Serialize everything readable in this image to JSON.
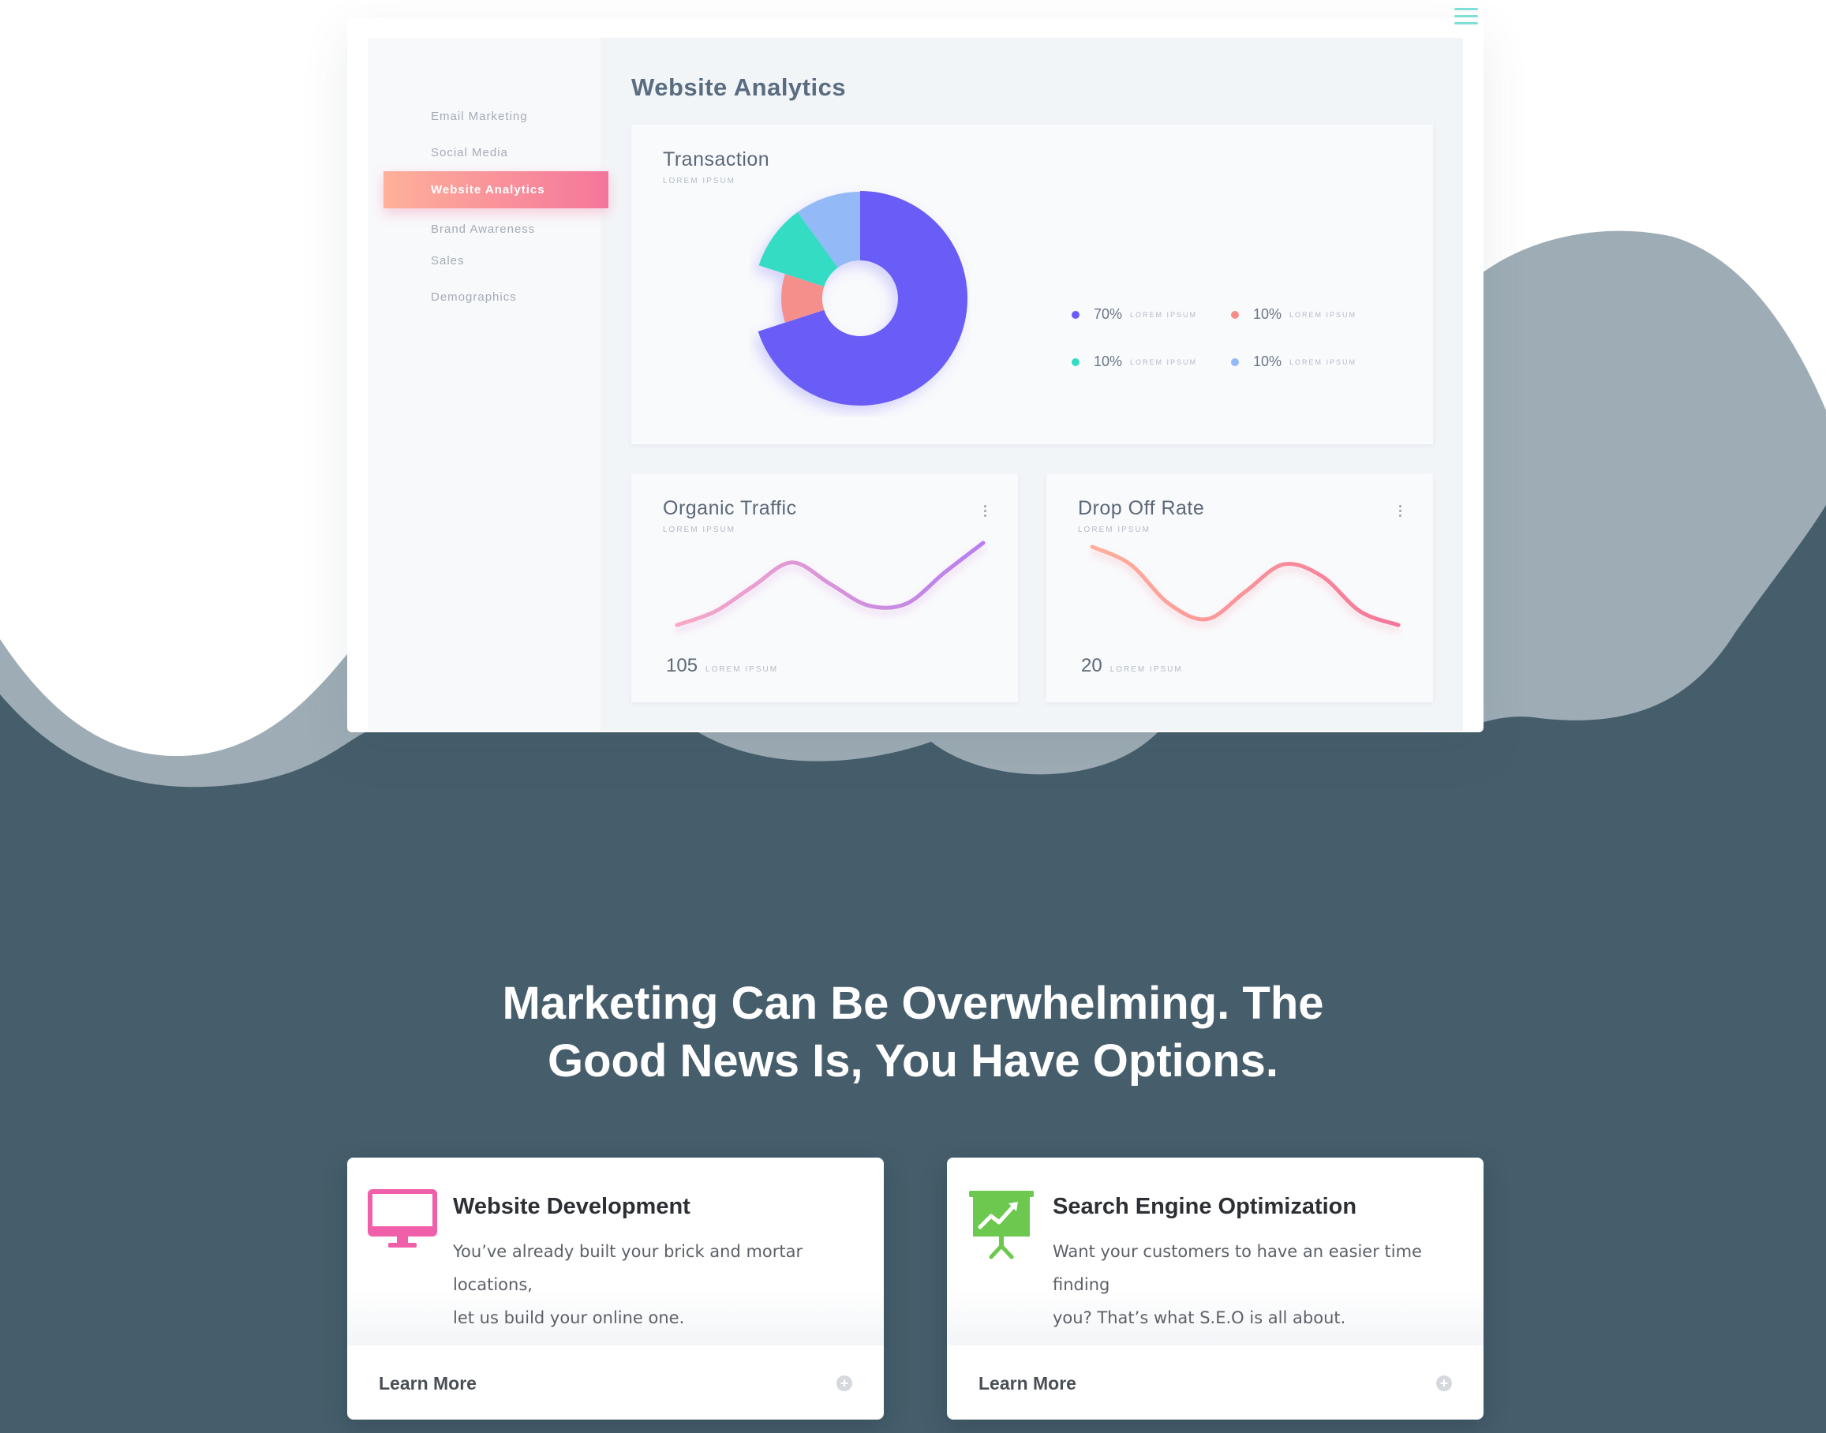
{
  "colors": {
    "dark_band": "#465e6b",
    "wave_gray": "#9eadb5",
    "accent_pink": "#f4769b",
    "accent_peach": "#ffb09a",
    "donut_purple": "#6a5cf6",
    "donut_teal": "#35dcc4",
    "donut_coral": "#f58f8c",
    "donut_blue": "#93b9f7",
    "seo_green": "#6cc84f",
    "monitor_pink": "#f060aa"
  },
  "header": {
    "menu_icon": "hamburger-icon"
  },
  "sidebar": {
    "items": [
      {
        "label": "Email Marketing",
        "active": false
      },
      {
        "label": "Social Media",
        "active": false
      },
      {
        "label": "Website Analytics",
        "active": true
      },
      {
        "label": "Brand Awareness",
        "active": false
      },
      {
        "label": "Sales",
        "active": false
      },
      {
        "label": "Demographics",
        "active": false
      }
    ]
  },
  "main": {
    "title": "Website Analytics"
  },
  "transaction": {
    "title": "Transaction",
    "subtitle": "LOREM IPSUM",
    "legend": [
      {
        "pct": "70%",
        "label": "LOREM IPSUM",
        "color": "#6a5cf6"
      },
      {
        "pct": "10%",
        "label": "LOREM IPSUM",
        "color": "#f58f8c"
      },
      {
        "pct": "10%",
        "label": "LOREM IPSUM",
        "color": "#35dcc4"
      },
      {
        "pct": "10%",
        "label": "LOREM IPSUM",
        "color": "#93b9f7"
      }
    ]
  },
  "organic": {
    "title": "Organic Traffic",
    "subtitle": "LOREM IPSUM",
    "value": "105",
    "value_label": "LOREM IPSUM",
    "menu_icon": "kebab-icon"
  },
  "dropoff": {
    "title": "Drop Off Rate",
    "subtitle": "LOREM IPSUM",
    "value": "20",
    "value_label": "LOREM IPSUM",
    "menu_icon": "kebab-icon"
  },
  "headline": {
    "line1": "Marketing Can Be Overwhelming. The",
    "line2": "Good News Is, You Have Options."
  },
  "cards": [
    {
      "icon": "monitor-icon",
      "title": "Website Development",
      "desc_line1": "You’ve already built your brick and mortar locations,",
      "desc_line2": "let us build your online one.",
      "link": "Learn More",
      "link_icon": "plus-circle-icon"
    },
    {
      "icon": "presentation-chart-icon",
      "title": "Search Engine Optimization",
      "desc_line1": "Want your customers to have an easier time finding",
      "desc_line2": "you? That’s what S.E.O is all about.",
      "link": "Learn More",
      "link_icon": "plus-circle-icon"
    }
  ],
  "chart_data": [
    {
      "type": "pie",
      "title": "Transaction",
      "slices": [
        {
          "label": "LOREM IPSUM",
          "value": 70,
          "color": "#6a5cf6"
        },
        {
          "label": "LOREM IPSUM",
          "value": 10,
          "color": "#f58f8c"
        },
        {
          "label": "LOREM IPSUM",
          "value": 10,
          "color": "#35dcc4"
        },
        {
          "label": "LOREM IPSUM",
          "value": 10,
          "color": "#93b9f7"
        }
      ]
    },
    {
      "type": "line",
      "title": "Organic Traffic",
      "x": [
        0,
        1,
        2,
        3,
        4,
        5,
        6,
        7,
        8
      ],
      "y": [
        8,
        22,
        48,
        72,
        50,
        28,
        30,
        62,
        92
      ],
      "grid": false
    },
    {
      "type": "line",
      "title": "Drop Off Rate",
      "x": [
        0,
        1,
        2,
        3,
        4,
        5,
        6,
        7,
        8
      ],
      "y": [
        88,
        70,
        30,
        14,
        42,
        70,
        58,
        22,
        8
      ],
      "grid": false
    }
  ]
}
